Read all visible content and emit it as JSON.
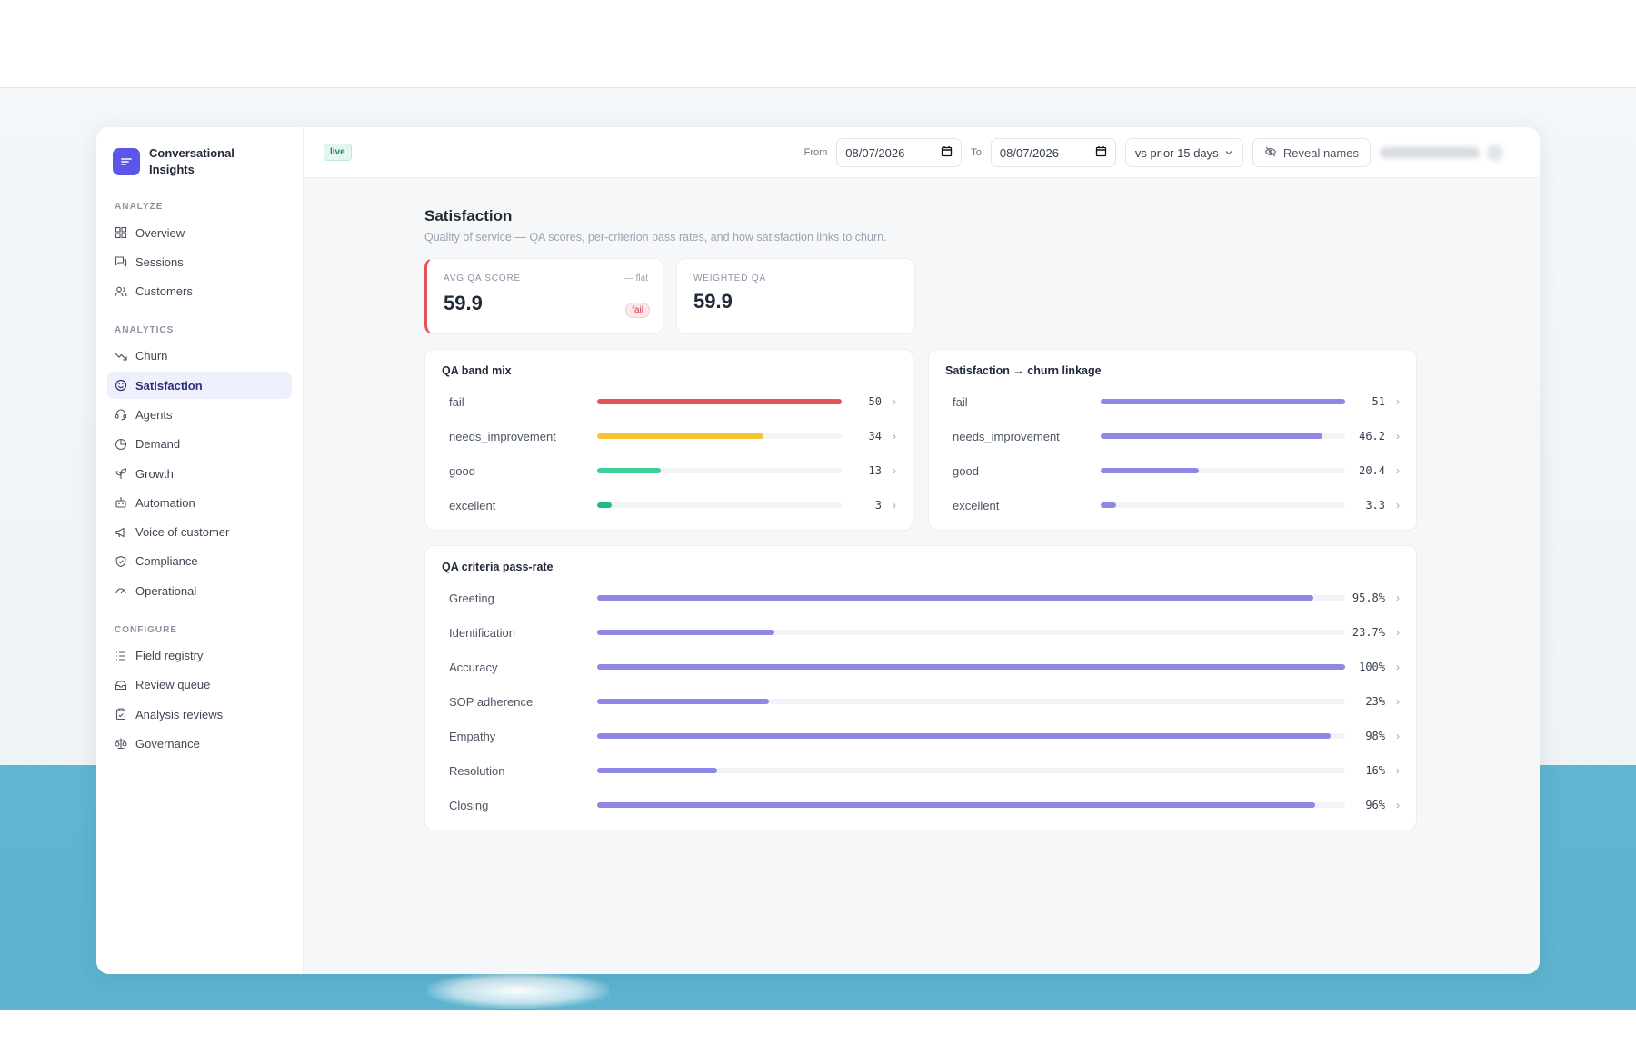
{
  "app": {
    "brand_line1": "Conversational",
    "brand_line2": "Insights"
  },
  "sidebar": {
    "analyze_title": "ANALYZE",
    "analyze_items": [
      "Overview",
      "Sessions",
      "Customers"
    ],
    "analytics_title": "ANALYTICS",
    "analytics_items": [
      "Churn",
      "Satisfaction",
      "Agents",
      "Demand",
      "Growth",
      "Automation",
      "Voice of customer",
      "Compliance",
      "Operational"
    ],
    "active_item": "Satisfaction",
    "configure_title": "CONFIGURE",
    "configure_items": [
      "Field registry",
      "Review queue",
      "Analysis reviews",
      "Governance"
    ]
  },
  "topbar": {
    "live_label": "live",
    "from_label": "From",
    "from_date": "08/07/2026",
    "to_label": "To",
    "to_date": "08/07/2026",
    "compare_value": "vs prior 15 days",
    "reveal_label": "Reveal names"
  },
  "page": {
    "title": "Satisfaction",
    "subtitle": "Quality of service — QA scores, per-criterion pass rates, and how satisfaction links to churn."
  },
  "kpis": {
    "avg_label": "AVG QA SCORE",
    "avg_value": "59.9",
    "avg_trend": "— flat",
    "avg_badge": "fail",
    "weighted_label": "WEIGHTED QA",
    "weighted_value": "59.9"
  },
  "colors": {
    "fail": "#e4535a",
    "needs_improvement": "#f5c430",
    "good": "#3ccf96",
    "excellent": "#1ebc80",
    "purple": "#8f87e6"
  },
  "chart_data": [
    {
      "type": "bar",
      "title": "QA band mix",
      "categories": [
        "fail",
        "needs_improvement",
        "good",
        "excellent"
      ],
      "values": [
        50,
        34,
        13,
        3
      ],
      "labels": [
        "50",
        "34",
        "13",
        "3"
      ],
      "max": 50
    },
    {
      "type": "bar",
      "title": "Satisfaction → churn linkage",
      "categories": [
        "fail",
        "needs_improvement",
        "good",
        "excellent"
      ],
      "values": [
        51,
        46.2,
        20.4,
        3.3
      ],
      "labels": [
        "51",
        "46.2",
        "20.4",
        "3.3"
      ],
      "max": 51
    },
    {
      "type": "bar",
      "title": "QA criteria pass-rate",
      "categories": [
        "Greeting",
        "Identification",
        "Accuracy",
        "SOP adherence",
        "Empathy",
        "Resolution",
        "Closing"
      ],
      "values": [
        95.8,
        23.7,
        100,
        23,
        98,
        16,
        96
      ],
      "labels": [
        "95.8%",
        "23.7%",
        "100%",
        "23%",
        "98%",
        "16%",
        "96%"
      ],
      "max": 100
    }
  ]
}
